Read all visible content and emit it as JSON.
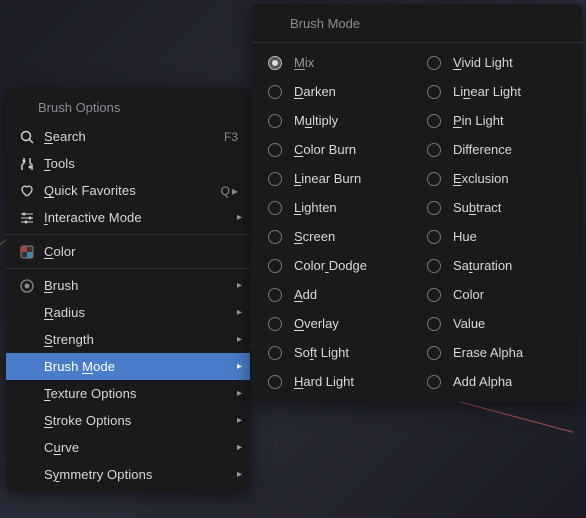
{
  "left": {
    "title": "Brush Options",
    "groups": [
      [
        {
          "icon": "search-icon",
          "label": "Search",
          "ul": 0,
          "shortcut": "F3",
          "sub": false,
          "name": "search-item"
        },
        {
          "icon": "tools-icon",
          "label": "Tools",
          "ul": 0,
          "sub": false,
          "name": "tools-item"
        },
        {
          "icon": "heart-icon",
          "label": "Quick Favorites",
          "ul": 0,
          "shortcut": "Q",
          "arrow": true,
          "sub": false,
          "name": "favorites-item"
        },
        {
          "icon": "sliders-icon",
          "label": "Interactive Mode",
          "ul": 0,
          "sub": true,
          "name": "interactive-mode-item"
        }
      ],
      [
        {
          "icon": "color-icon",
          "label": "Color",
          "ul": 0,
          "sub": false,
          "name": "color-item"
        }
      ],
      [
        {
          "icon": "brush-icon",
          "label": "Brush",
          "ul": 0,
          "sub": true,
          "name": "brush-submenu"
        },
        {
          "label": "Radius",
          "ul": 0,
          "sub": true,
          "name": "radius-submenu"
        },
        {
          "label": "Strength",
          "ul": 0,
          "sub": true,
          "name": "strength-submenu"
        },
        {
          "label": "Brush Mode",
          "ul": 6,
          "sub": true,
          "name": "brush-mode-submenu",
          "active": true
        },
        {
          "label": "Texture Options",
          "ul": 0,
          "sub": true,
          "name": "texture-options-submenu"
        },
        {
          "label": "Stroke Options",
          "ul": 0,
          "sub": true,
          "name": "stroke-options-submenu"
        },
        {
          "label": "Curve",
          "ul": 1,
          "sub": true,
          "name": "curve-submenu"
        },
        {
          "label": "Symmetry Options",
          "ul": 1,
          "sub": true,
          "name": "symmetry-options-submenu"
        }
      ]
    ]
  },
  "right": {
    "title": "Brush Mode",
    "columns": [
      [
        {
          "label": "Mix",
          "ul": 0,
          "selected": true,
          "name": "mode-mix"
        },
        {
          "label": "Darken",
          "ul": 0,
          "name": "mode-darken"
        },
        {
          "label": "Multiply",
          "ul": 1,
          "name": "mode-multiply"
        },
        {
          "label": "Color Burn",
          "ul": 0,
          "name": "mode-color-burn"
        },
        {
          "label": "Linear Burn",
          "ul": 0,
          "name": "mode-linear-burn"
        },
        {
          "label": "Lighten",
          "ul": 0,
          "name": "mode-lighten"
        },
        {
          "label": "Screen",
          "ul": 0,
          "name": "mode-screen"
        },
        {
          "label": "Color Dodge",
          "ul": 5,
          "name": "mode-color-dodge"
        },
        {
          "label": "Add",
          "ul": 0,
          "name": "mode-add"
        },
        {
          "label": "Overlay",
          "ul": 0,
          "name": "mode-overlay"
        },
        {
          "label": "Soft Light",
          "ul": 2,
          "name": "mode-soft-light"
        },
        {
          "label": "Hard Light",
          "ul": 0,
          "name": "mode-hard-light"
        }
      ],
      [
        {
          "label": "Vivid Light",
          "ul": 0,
          "name": "mode-vivid-light"
        },
        {
          "label": "Linear Light",
          "ul": 2,
          "name": "mode-linear-light"
        },
        {
          "label": "Pin Light",
          "ul": 0,
          "name": "mode-pin-light"
        },
        {
          "label": "Difference",
          "ul": -1,
          "name": "mode-difference"
        },
        {
          "label": "Exclusion",
          "ul": 0,
          "name": "mode-exclusion"
        },
        {
          "label": "Subtract",
          "ul": 2,
          "name": "mode-subtract"
        },
        {
          "label": "Hue",
          "ul": -1,
          "name": "mode-hue"
        },
        {
          "label": "Saturation",
          "ul": 2,
          "name": "mode-saturation"
        },
        {
          "label": "Color",
          "ul": -1,
          "name": "mode-color"
        },
        {
          "label": "Value",
          "ul": -1,
          "name": "mode-value"
        },
        {
          "label": "Erase Alpha",
          "ul": -1,
          "name": "mode-erase-alpha"
        },
        {
          "label": "Add Alpha",
          "ul": -1,
          "name": "mode-add-alpha"
        }
      ]
    ]
  }
}
